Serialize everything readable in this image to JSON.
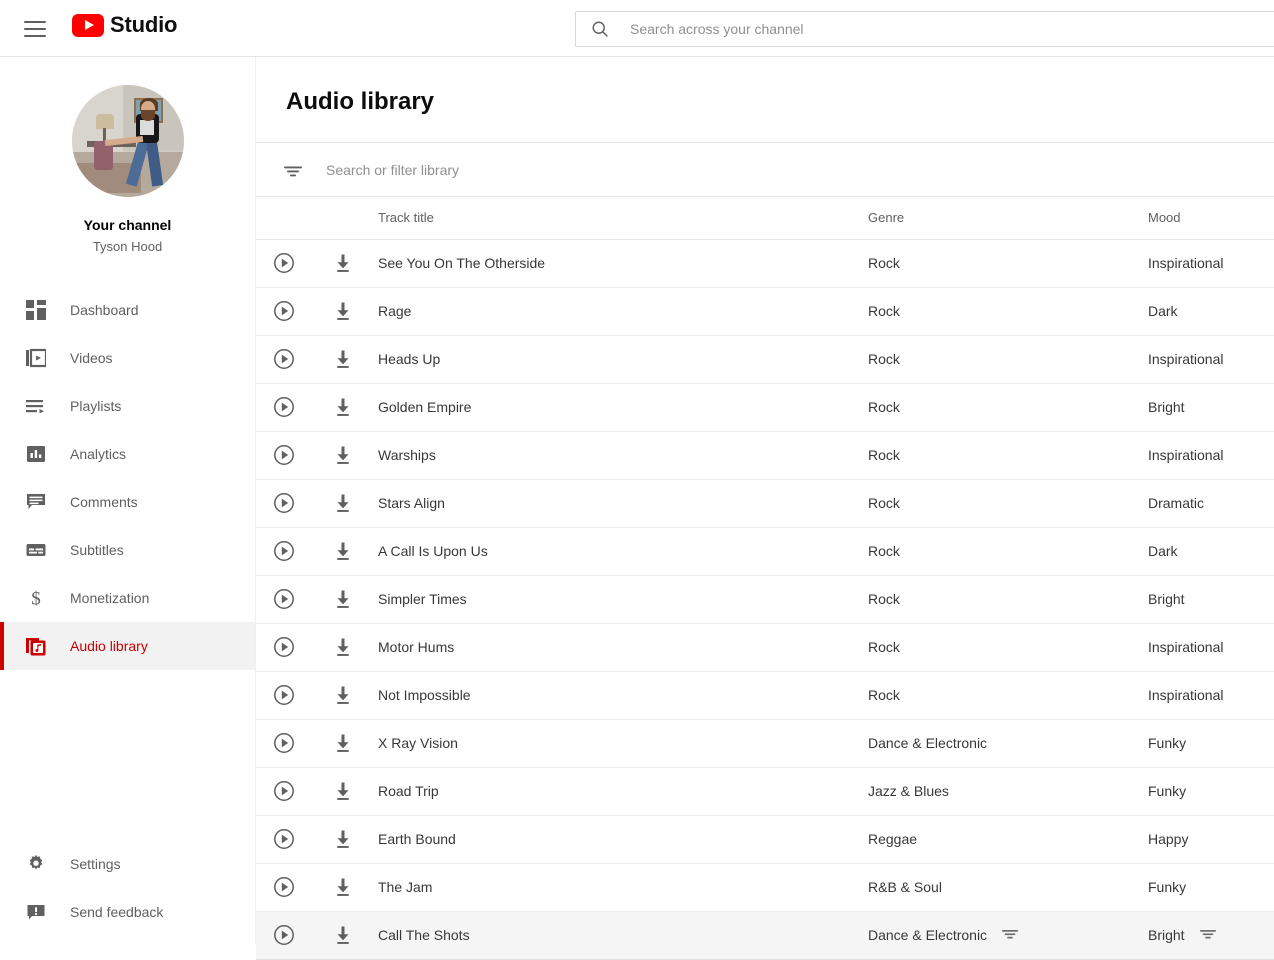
{
  "topbar": {
    "menu_icon": "hamburger-icon",
    "logo_icon": "youtube-play-badge-icon",
    "brand": "Studio",
    "search_icon": "search-icon",
    "search_placeholder": "Search across your channel",
    "search_value": ""
  },
  "sidebar": {
    "avatar_name": "channel-avatar",
    "channel_title": "Your channel",
    "channel_name": "Tyson Hood",
    "items": [
      {
        "label": "Dashboard",
        "icon": "dashboard-icon",
        "active": false
      },
      {
        "label": "Videos",
        "icon": "videos-icon",
        "active": false
      },
      {
        "label": "Playlists",
        "icon": "playlists-icon",
        "active": false
      },
      {
        "label": "Analytics",
        "icon": "analytics-icon",
        "active": false
      },
      {
        "label": "Comments",
        "icon": "comments-icon",
        "active": false
      },
      {
        "label": "Subtitles",
        "icon": "subtitles-icon",
        "active": false
      },
      {
        "label": "Monetization",
        "icon": "monetization-icon",
        "active": false
      },
      {
        "label": "Audio library",
        "icon": "audio-library-icon",
        "active": true
      }
    ],
    "bottom_items": [
      {
        "label": "Settings",
        "icon": "gear-icon"
      },
      {
        "label": "Send feedback",
        "icon": "feedback-icon"
      }
    ]
  },
  "main": {
    "page_title": "Audio library",
    "filter": {
      "icon": "filter-icon",
      "placeholder": "Search or filter library",
      "value": ""
    },
    "columns": {
      "play": "",
      "download": "",
      "title": "Track title",
      "genre": "Genre",
      "mood": "Mood"
    },
    "row_icons": {
      "play": "play-circle-icon",
      "download": "download-icon",
      "filter": "filter-icon"
    },
    "tracks": [
      {
        "title": "See You On The Otherside",
        "genre": "Rock",
        "mood": "Inspirational",
        "hovered": false
      },
      {
        "title": "Rage",
        "genre": "Rock",
        "mood": "Dark",
        "hovered": false
      },
      {
        "title": "Heads Up",
        "genre": "Rock",
        "mood": "Inspirational",
        "hovered": false
      },
      {
        "title": "Golden Empire",
        "genre": "Rock",
        "mood": "Bright",
        "hovered": false
      },
      {
        "title": "Warships",
        "genre": "Rock",
        "mood": "Inspirational",
        "hovered": false
      },
      {
        "title": "Stars Align",
        "genre": "Rock",
        "mood": "Dramatic",
        "hovered": false
      },
      {
        "title": "A Call Is Upon Us",
        "genre": "Rock",
        "mood": "Dark",
        "hovered": false
      },
      {
        "title": "Simpler Times",
        "genre": "Rock",
        "mood": "Bright",
        "hovered": false
      },
      {
        "title": "Motor Hums",
        "genre": "Rock",
        "mood": "Inspirational",
        "hovered": false
      },
      {
        "title": "Not Impossible",
        "genre": "Rock",
        "mood": "Inspirational",
        "hovered": false
      },
      {
        "title": "X Ray Vision",
        "genre": "Dance & Electronic",
        "mood": "Funky",
        "hovered": false
      },
      {
        "title": "Road Trip",
        "genre": "Jazz & Blues",
        "mood": "Funky",
        "hovered": false
      },
      {
        "title": "Earth Bound",
        "genre": "Reggae",
        "mood": "Happy",
        "hovered": false
      },
      {
        "title": "The Jam",
        "genre": "R&B & Soul",
        "mood": "Funky",
        "hovered": false
      },
      {
        "title": "Call The Shots",
        "genre": "Dance & Electronic",
        "mood": "Bright",
        "hovered": true
      }
    ]
  },
  "colors": {
    "brand_red": "#FF0000",
    "active_red": "#CC0000",
    "text_primary": "#030303",
    "text_secondary": "#606060",
    "hover_row": "#f5f5f5"
  }
}
